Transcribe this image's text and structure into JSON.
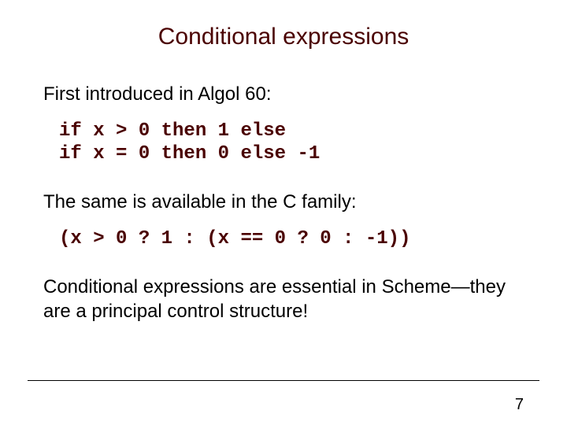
{
  "title": "Conditional expressions",
  "para1": "First introduced in Algol 60:",
  "code1": "if x > 0 then 1 else\nif x = 0 then 0 else -1",
  "para2": "The same is available in the C family:",
  "code2": "(x > 0 ? 1 : (x == 0 ? 0 : -1))",
  "para3": "Conditional expressions are essential in Scheme—they are a principal control structure!",
  "page": "7"
}
